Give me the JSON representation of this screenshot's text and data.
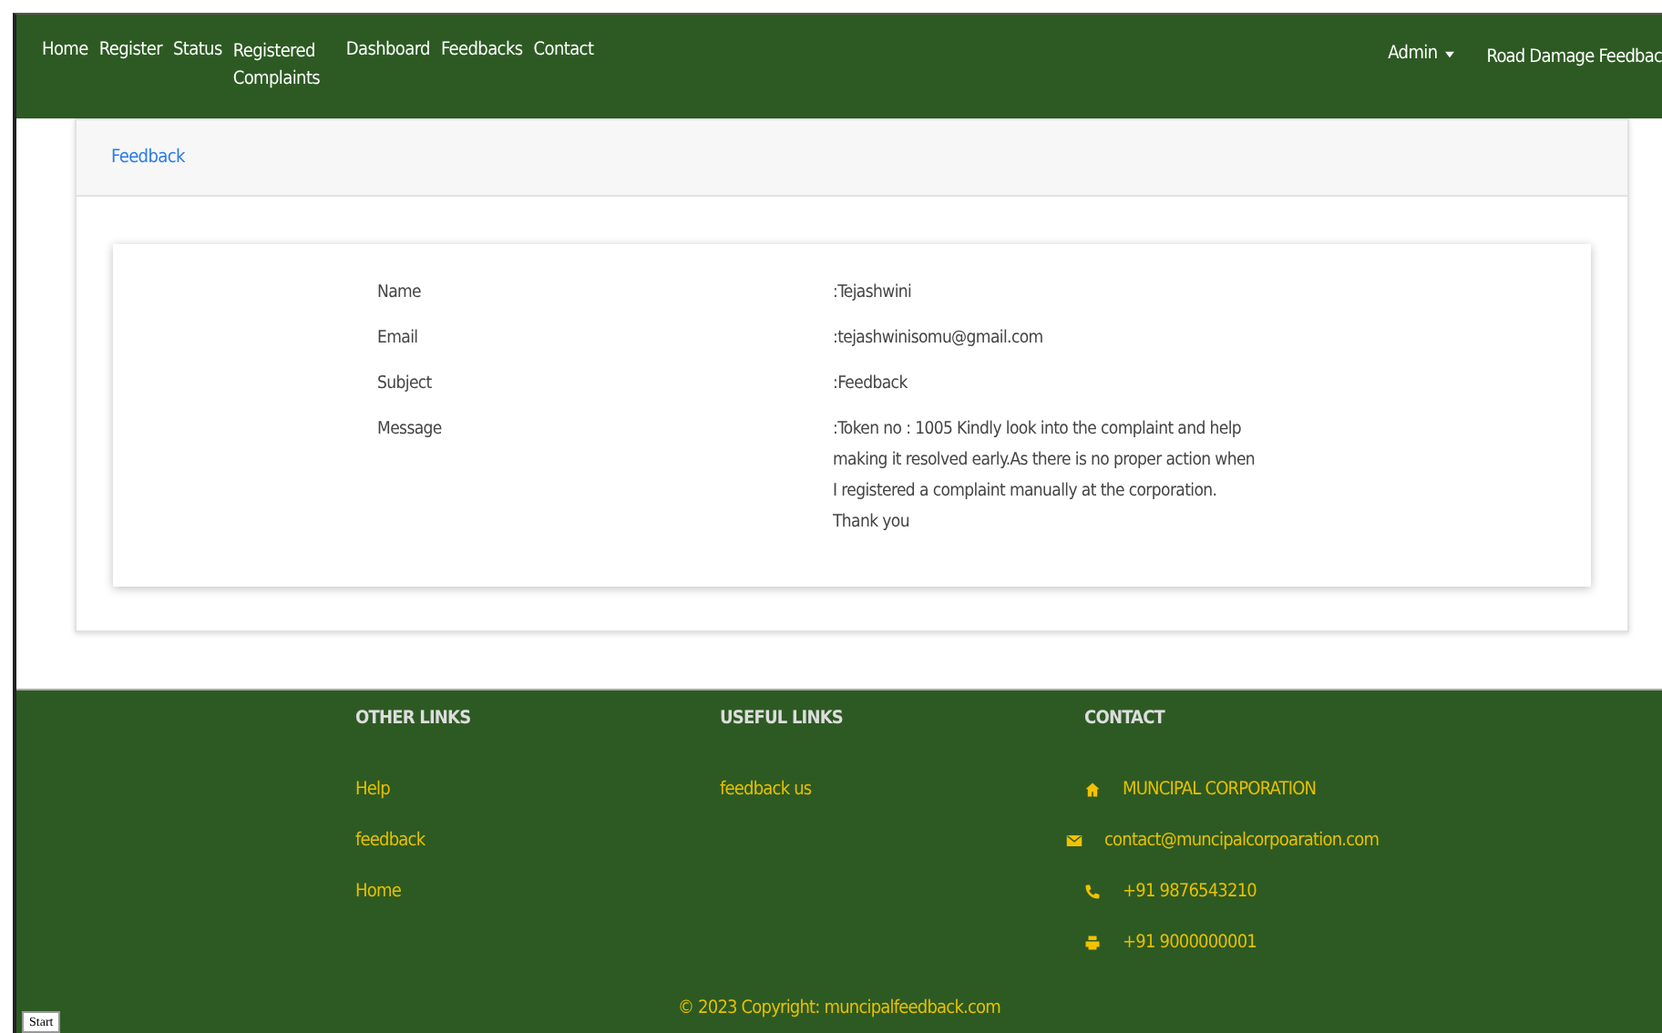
{
  "navbar": {
    "links": [
      {
        "label": "Home"
      },
      {
        "label": "Register"
      },
      {
        "label": "Status"
      },
      {
        "label": "Registered Complaints"
      },
      {
        "label": "Dashboard"
      },
      {
        "label": "Feedbacks"
      },
      {
        "label": "Contact"
      }
    ],
    "user_menu": {
      "label": "Admin"
    },
    "brand": "Road Damage Feedbac"
  },
  "card": {
    "header_link": "Feedback",
    "fields": [
      {
        "label": "Name",
        "value": ":Tejashwini"
      },
      {
        "label": "Email",
        "value": ":tejashwinisomu@gmail.com"
      },
      {
        "label": "Subject",
        "value": ":Feedback"
      },
      {
        "label": "Message",
        "value": ":Token no : 1005 Kindly look into the complaint and help making it resolved early.As there is no proper action when I registered a complaint manually at the corporation. Thank you"
      }
    ]
  },
  "footer": {
    "columns": [
      {
        "heading": "OTHER LINKS",
        "items": [
          {
            "label": "Help"
          },
          {
            "label": "feedback"
          },
          {
            "label": "Home"
          }
        ]
      },
      {
        "heading": "USEFUL LINKS",
        "items": [
          {
            "label": "feedback us"
          }
        ]
      },
      {
        "heading": "CONTACT",
        "items": [
          {
            "kind": "home",
            "label": "MUNCIPAL CORPORATION"
          },
          {
            "kind": "email",
            "label": "contact@muncipalcorpoaration.com"
          },
          {
            "kind": "phone",
            "label": "+91 9876543210"
          },
          {
            "kind": "print",
            "label": "+91 9000000001"
          }
        ]
      }
    ],
    "copyright": "© 2023 Copyright: muncipalfeedback.com"
  },
  "start_button": "Start"
}
